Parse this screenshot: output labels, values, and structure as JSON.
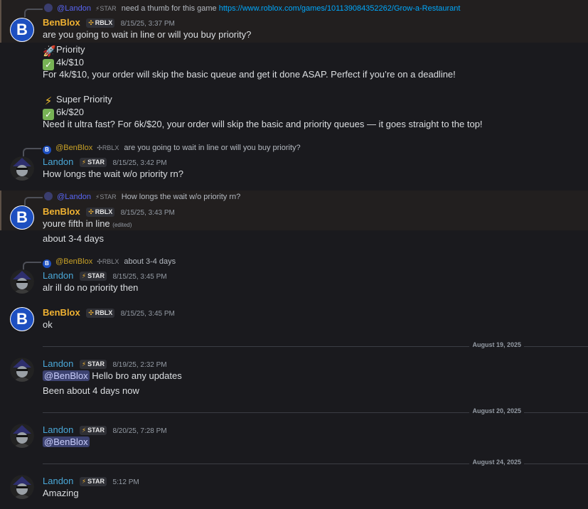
{
  "users": {
    "benblox": {
      "name": "BenBlox",
      "tag": "RBLX"
    },
    "landon": {
      "name": "Landon",
      "tag": "STAR"
    }
  },
  "messages": [
    {
      "reply": {
        "author": "@Landon",
        "tag": "STAR",
        "text": "need a thumb for this game",
        "link": "https://www.roblox.com/games/101139084352262/Grow-a-Restaurant"
      },
      "time": "8/15/25, 3:37 PM",
      "lines": [
        "are you going to wait in line or will you buy priority?",
        "Priority",
        "4k/$10",
        "For 4k/$10, your order will skip the basic queue and get it done ASAP. Perfect if you’re on a deadline!",
        "Super Priority",
        "6k/$20",
        "Need it ultra fast? For 6k/$20, your order will skip the basic and priority queues — it goes straight to the top!"
      ]
    },
    {
      "reply": {
        "author": "@BenBlox",
        "tag": "RBLX",
        "text": "are you going to wait in line or will you buy priority?"
      },
      "time": "8/15/25, 3:42 PM",
      "lines": [
        "How longs the wait w/o priority rn?"
      ]
    },
    {
      "reply": {
        "author": "@Landon",
        "tag": "STAR",
        "text": "How longs the wait w/o priority rn?"
      },
      "time": "8/15/25, 3:43 PM",
      "lines": [
        "youre fifth in line",
        "(edited)",
        "about 3-4 days"
      ]
    },
    {
      "reply": {
        "author": "@BenBlox",
        "tag": "RBLX",
        "text": "about 3-4 days"
      },
      "time": "8/15/25, 3:45 PM",
      "lines": [
        "alr ill do no priority then"
      ]
    },
    {
      "time": "8/15/25, 3:45 PM",
      "lines": [
        "ok"
      ]
    },
    {
      "divider": "August 19, 2025",
      "time": "8/19/25, 2:32 PM",
      "mention": "@BenBlox",
      "lines": [
        "Hello bro any updates",
        "Been about 4 days now"
      ]
    },
    {
      "divider": "August 20, 2025",
      "time": "8/20/25, 7:28 PM",
      "mention": "@BenBlox"
    },
    {
      "divider": "August 24, 2025",
      "time": "5:12 PM",
      "lines": [
        "Amazing"
      ]
    }
  ],
  "icons": [
    "reply-spine",
    "avatar-benblox",
    "avatar-landon",
    "rocket-emoji",
    "check-emoji",
    "zap-emoji",
    "rblx-tag-icon",
    "star-tag-icon"
  ],
  "colors": {
    "background": "#1a1a1e",
    "benblox_name": "#f0b232",
    "landon_name": "#4aa8d8",
    "link": "#00a8fc",
    "mention_bg": "#3c4270"
  }
}
